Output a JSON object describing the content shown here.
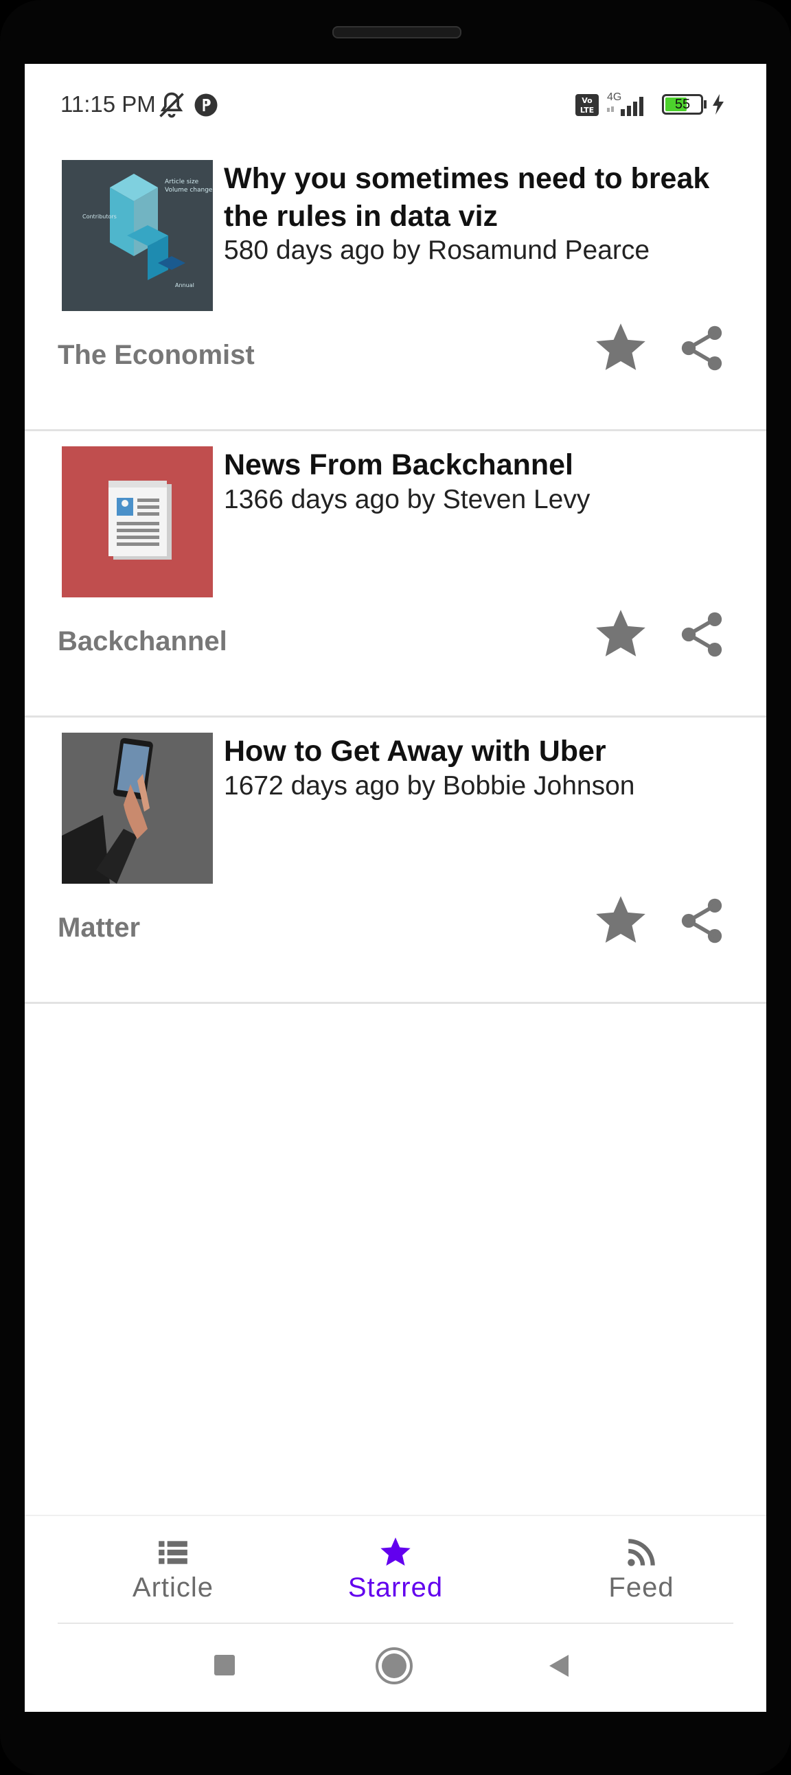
{
  "status_bar": {
    "time": "11:15 PM",
    "battery": "55",
    "network": "4G",
    "volte": "Vo LTE"
  },
  "articles": [
    {
      "title": "Why you sometimes need to break the rules in data viz",
      "meta": "580 days ago by Rosamund Pearce",
      "source": "The Economist",
      "thumbnail_icon": "data-viz-thumbnail"
    },
    {
      "title": "News From Backchannel",
      "meta": "1366 days ago by Steven Levy",
      "source": "Backchannel",
      "thumbnail_icon": "newspaper-thumbnail"
    },
    {
      "title": "How to Get Away with Uber",
      "meta": "1672 days ago by Bobbie Johnson",
      "source": "Matter",
      "thumbnail_icon": "phone-hand-thumbnail"
    }
  ],
  "bottom_nav": {
    "items": [
      {
        "label": "Article",
        "icon": "list-icon",
        "active": false
      },
      {
        "label": "Starred",
        "icon": "star-icon",
        "active": true
      },
      {
        "label": "Feed",
        "icon": "rss-icon",
        "active": false
      }
    ]
  },
  "colors": {
    "accent": "#6200ee",
    "icon_gray": "#757575",
    "inactive_text": "#6b6b6b"
  }
}
